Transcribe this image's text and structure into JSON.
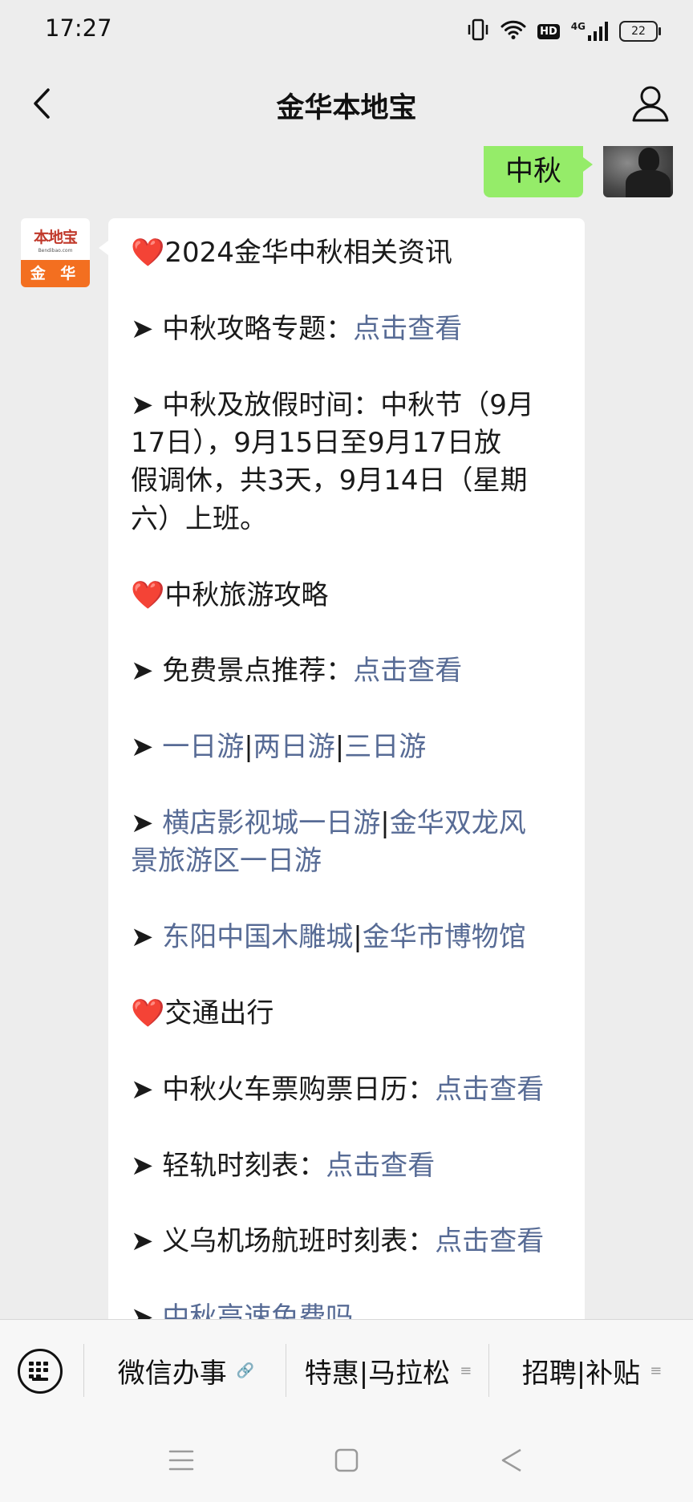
{
  "status_bar": {
    "time": "17:27",
    "network": "4G",
    "hd_label": "HD",
    "battery": "22"
  },
  "header": {
    "title": "金华本地宝"
  },
  "chat": {
    "sent_message": "中秋",
    "bot_avatar": {
      "logo_text": "本地宝",
      "logo_url_text": "Bendibao.com",
      "city_label": "金 华"
    },
    "message_lines": [
      [
        {
          "t": "❤️",
          "c": "heart"
        },
        {
          "t": "2024金华中秋相关资讯"
        }
      ],
      [],
      [
        {
          "t": "➤ 中秋攻略专题："
        },
        {
          "t": "点击查看",
          "c": "link"
        }
      ],
      [],
      [
        {
          "t": "➤ 中秋及放假时间：中秋节（9月"
        }
      ],
      [
        {
          "t": "17日），9月15日至9月17日放"
        }
      ],
      [
        {
          "t": "假调休，共3天，9月14日（星期"
        }
      ],
      [
        {
          "t": "六）上班。"
        }
      ],
      [],
      [
        {
          "t": "❤️",
          "c": "heart"
        },
        {
          "t": "中秋旅游攻略"
        }
      ],
      [],
      [
        {
          "t": "➤ 免费景点推荐："
        },
        {
          "t": "点击查看",
          "c": "link"
        }
      ],
      [],
      [
        {
          "t": "➤ "
        },
        {
          "t": "一日游",
          "c": "link"
        },
        {
          "t": "|"
        },
        {
          "t": "两日游",
          "c": "link"
        },
        {
          "t": "|"
        },
        {
          "t": "三日游",
          "c": "link"
        }
      ],
      [],
      [
        {
          "t": "➤ "
        },
        {
          "t": "横店影视城一日游",
          "c": "link"
        },
        {
          "t": "|"
        },
        {
          "t": "金华双龙风",
          "c": "link"
        }
      ],
      [
        {
          "t": "景旅游区一日游",
          "c": "link"
        }
      ],
      [],
      [
        {
          "t": "➤ "
        },
        {
          "t": "东阳中国木雕城",
          "c": "link"
        },
        {
          "t": "|"
        },
        {
          "t": "金华市博物馆",
          "c": "link"
        }
      ],
      [],
      [
        {
          "t": "❤️",
          "c": "heart"
        },
        {
          "t": "交通出行"
        }
      ],
      [],
      [
        {
          "t": "➤ 中秋火车票购票日历："
        },
        {
          "t": "点击查看",
          "c": "link"
        }
      ],
      [],
      [
        {
          "t": "➤ 轻轨时刻表："
        },
        {
          "t": "点击查看",
          "c": "link"
        }
      ],
      [],
      [
        {
          "t": "➤ 义乌机场航班时刻表："
        },
        {
          "t": "点击查看",
          "c": "link"
        }
      ],
      [],
      [
        {
          "t": "➤ "
        },
        {
          "t": "中秋高速免费吗",
          "c": "link"
        }
      ]
    ]
  },
  "menu": {
    "items": [
      {
        "label": "微信办事",
        "suffix": "🔗"
      },
      {
        "label": "特惠|马拉松",
        "suffix": "≡"
      },
      {
        "label": "招聘|补贴",
        "suffix": "≡"
      }
    ]
  },
  "colors": {
    "link": "#576b95",
    "sent_bubble": "#95ec69",
    "heart": "#e0242f",
    "background": "#ededed"
  }
}
